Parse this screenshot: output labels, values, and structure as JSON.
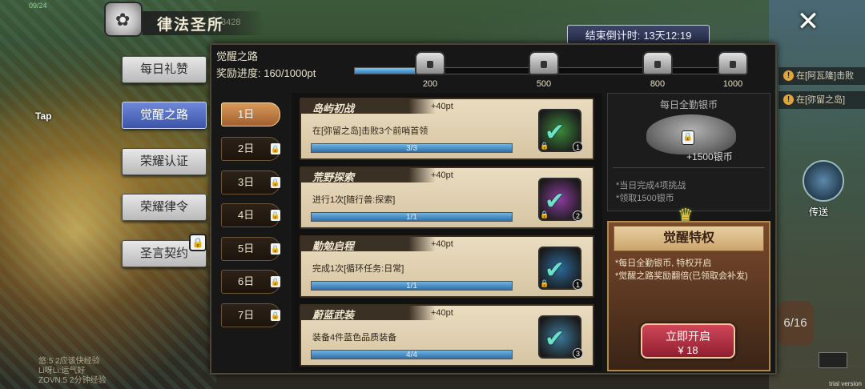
{
  "header": {
    "title": "律法圣所",
    "background_number": "3428",
    "countdown_label": "结束倒计时:",
    "countdown_value": "13天12:19",
    "close_icon": "close-icon"
  },
  "background": {
    "top_left_info": "09/24",
    "tap_logo": "Tap",
    "notices": [
      "在[阿瓦隆]击败",
      "在[弥留之岛]"
    ],
    "teleport_label": "传送",
    "page_counter": "6/16",
    "chat_lines": [
      "悠:5 2应该快经验",
      "Li呀Li:运气好",
      "ZOVN:5 2分钟经验"
    ],
    "watermark": "trial version"
  },
  "sidebar": {
    "items": [
      {
        "label": "每日礼赞",
        "active": false,
        "locked": false
      },
      {
        "label": "觉醒之路",
        "active": true,
        "locked": false
      },
      {
        "label": "荣耀认证",
        "active": false,
        "locked": false
      },
      {
        "label": "荣耀律令",
        "active": false,
        "locked": false
      },
      {
        "label": "圣言契约",
        "active": false,
        "locked": true
      }
    ]
  },
  "progress": {
    "title": "觉醒之路",
    "label": "奖励进度:",
    "current": 160,
    "max": 1000,
    "text": "160/1000pt",
    "milestones": [
      "200",
      "500",
      "800",
      "1000"
    ],
    "chest_icon": "silver-chest-icon"
  },
  "days": [
    {
      "label": "1日",
      "active": true,
      "locked": false
    },
    {
      "label": "2日",
      "active": false,
      "locked": true
    },
    {
      "label": "3日",
      "active": false,
      "locked": true
    },
    {
      "label": "4日",
      "active": false,
      "locked": true
    },
    {
      "label": "5日",
      "active": false,
      "locked": true
    },
    {
      "label": "6日",
      "active": false,
      "locked": true
    },
    {
      "label": "7日",
      "active": false,
      "locked": true
    }
  ],
  "tasks": [
    {
      "title": "岛屿初战",
      "points": "+40pt",
      "desc": "在[弥留之岛]击败3个前哨首领",
      "progress_text": "3/3",
      "progress": 1.0,
      "reward_count": "1",
      "icon": "green-fruit-check-icon",
      "icon_color": "#3c8a3c"
    },
    {
      "title": "荒野探索",
      "points": "+40pt",
      "desc": "进行1次[随行兽:探索]",
      "progress_text": "1/1",
      "progress": 1.0,
      "reward_count": "2",
      "icon": "purple-orb-check-icon",
      "icon_color": "#8a3c9c"
    },
    {
      "title": "勤勉启程",
      "points": "+40pt",
      "desc": "完成1次[循环任务:日常]",
      "progress_text": "1/1",
      "progress": 1.0,
      "reward_count": "1",
      "icon": "blue-gem-check-icon",
      "icon_color": "#2c6a9a"
    },
    {
      "title": "蔚蓝武装",
      "points": "+40pt",
      "desc": "装备4件蓝色品质装备",
      "progress_text": "4/4",
      "progress": 1.0,
      "reward_count": "3",
      "icon": "blue-crystal-check-icon",
      "icon_color": "#3c7a9a"
    }
  ],
  "daily_reward": {
    "title": "每日全勤银币",
    "amount": "+1500银币",
    "lines": [
      "*当日完成4项挑战",
      "*领取1500银币"
    ],
    "icon": "silver-coins-icon"
  },
  "privilege": {
    "title": "觉醒特权",
    "lines": [
      "*每日全勤银币, 特权开启",
      "*觉醒之路奖励翻倍(已领取会补发)"
    ],
    "button_label": "立即开启",
    "price": "¥  18",
    "crown_icon": "crown-icon"
  }
}
